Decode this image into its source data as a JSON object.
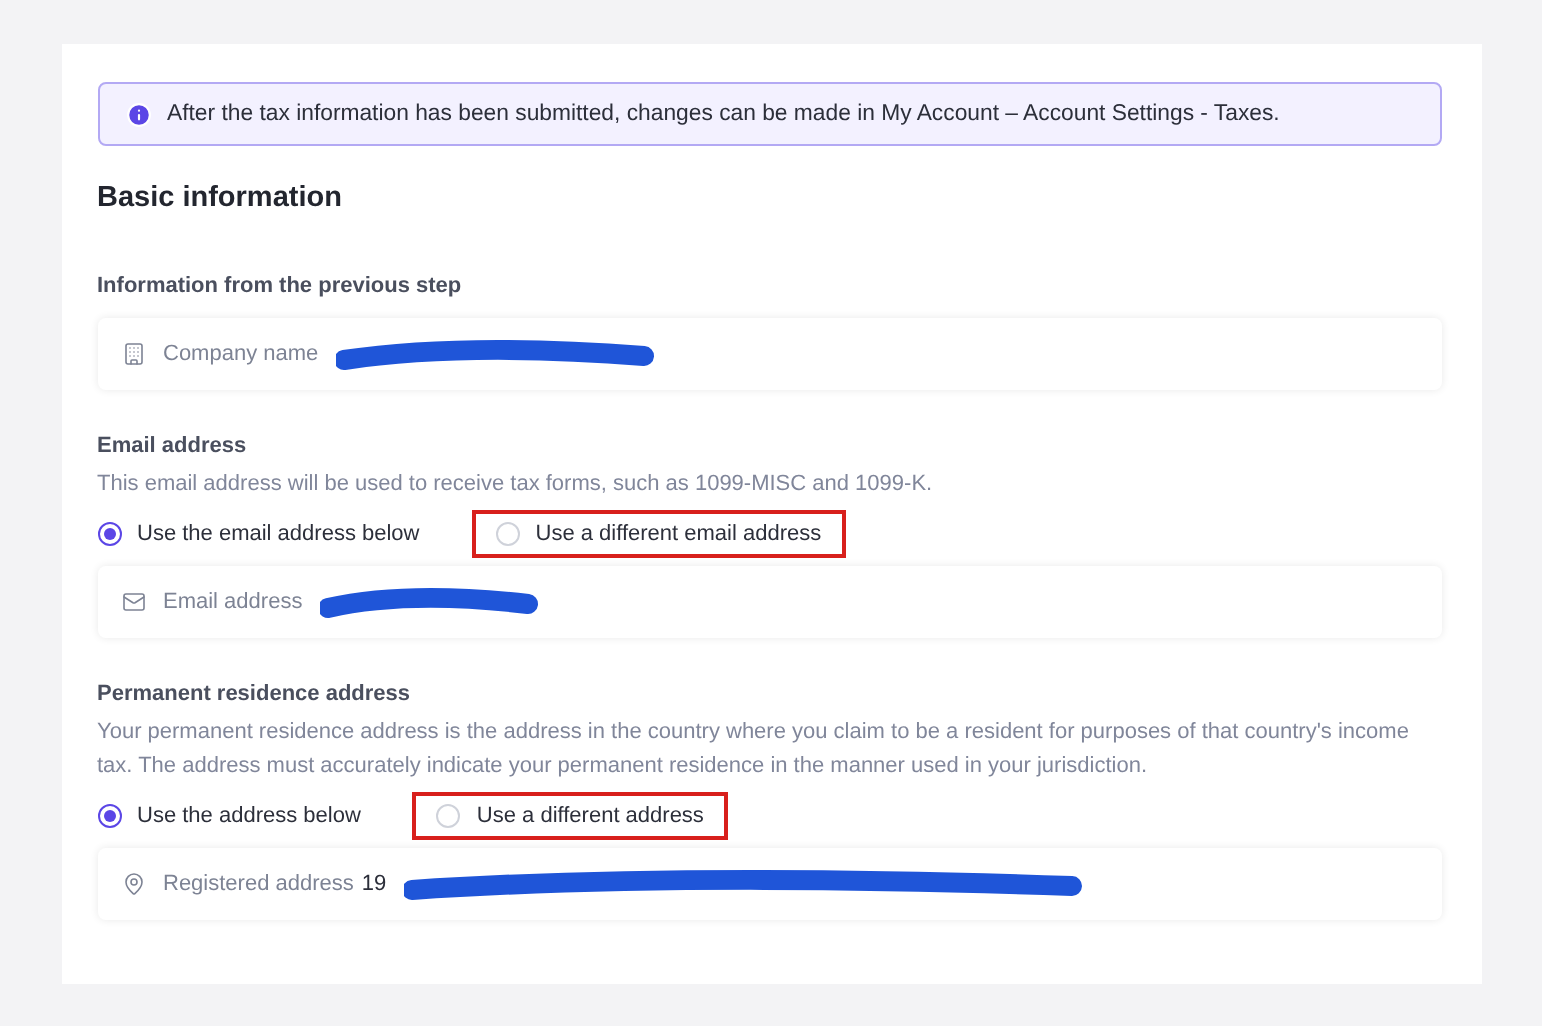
{
  "notice": {
    "text": "After the tax information has been submitted, changes can be made in My Account – Account Settings - Taxes."
  },
  "section_title": "Basic information",
  "groups": [
    {
      "label": "Information from the previous step",
      "field": {
        "kind": "building",
        "label": "Company name",
        "redacted": true
      }
    },
    {
      "label": "Email address",
      "description": "This email address will be used to receive tax forms, such as 1099-MISC and 1099-K.",
      "options": [
        {
          "label": "Use the email address below",
          "selected": true,
          "highlighted": false
        },
        {
          "label": "Use a different email address",
          "selected": false,
          "highlighted": true
        }
      ],
      "field": {
        "kind": "mail",
        "label": "Email address",
        "redacted": true
      }
    },
    {
      "label": "Permanent residence address",
      "description": "Your permanent residence address is the address in the country where you claim to be a resident for purposes of that country's income tax. The address must accurately indicate your permanent residence in the manner used in your jurisdiction.",
      "options": [
        {
          "label": "Use the address below",
          "selected": true,
          "highlighted": false
        },
        {
          "label": "Use a different address",
          "selected": false,
          "highlighted": true
        }
      ],
      "field": {
        "kind": "pin",
        "label": "Registered address",
        "value": "19",
        "redacted": true
      }
    }
  ]
}
